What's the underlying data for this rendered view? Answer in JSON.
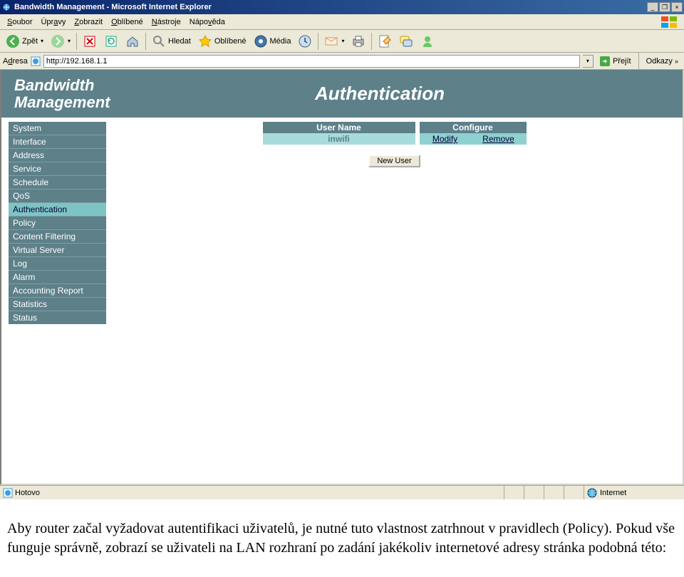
{
  "window": {
    "title": "Bandwidth Management - Microsoft Internet Explorer"
  },
  "menubar": {
    "items": [
      "Soubor",
      "Úpravy",
      "Zobrazit",
      "Oblíbené",
      "Nástroje",
      "Nápověda"
    ]
  },
  "toolbar": {
    "back": "Zpět",
    "search": "Hledat",
    "favorites": "Oblíbené",
    "media": "Média"
  },
  "addressbar": {
    "label": "Adresa",
    "url": "http://192.168.1.1",
    "go": "Přejít",
    "links": "Odkazy"
  },
  "banner": {
    "left_line1": "Bandwidth",
    "left_line2": "Management",
    "right": "Authentication"
  },
  "sidebar": {
    "items": [
      {
        "label": "System"
      },
      {
        "label": "Interface"
      },
      {
        "label": "Address"
      },
      {
        "label": "Service"
      },
      {
        "label": "Schedule"
      },
      {
        "label": "QoS"
      },
      {
        "label": "Authentication",
        "active": true
      },
      {
        "label": "Policy"
      },
      {
        "label": "Content Filtering"
      },
      {
        "label": "Virtual Server"
      },
      {
        "label": "Log"
      },
      {
        "label": "Alarm"
      },
      {
        "label": "Accounting Report"
      },
      {
        "label": "Statistics"
      },
      {
        "label": "Status"
      }
    ]
  },
  "auth": {
    "head_user": "User Name",
    "head_conf": "Configure",
    "row_user": "inwifi",
    "row_modify": "Modify",
    "row_remove": "Remove",
    "new_user": "New User"
  },
  "statusbar": {
    "left": "Hotovo",
    "right": "Internet"
  },
  "caption": {
    "text": "Aby router začal vyžadovat autentifikaci uživatelů, je nutné tuto vlastnost zatrhnout v pravidlech (Policy). Pokud vše funguje správně, zobrazí se uživateli na LAN rozhraní po zadání jakékoliv internetové adresy stránka podobná této:"
  }
}
